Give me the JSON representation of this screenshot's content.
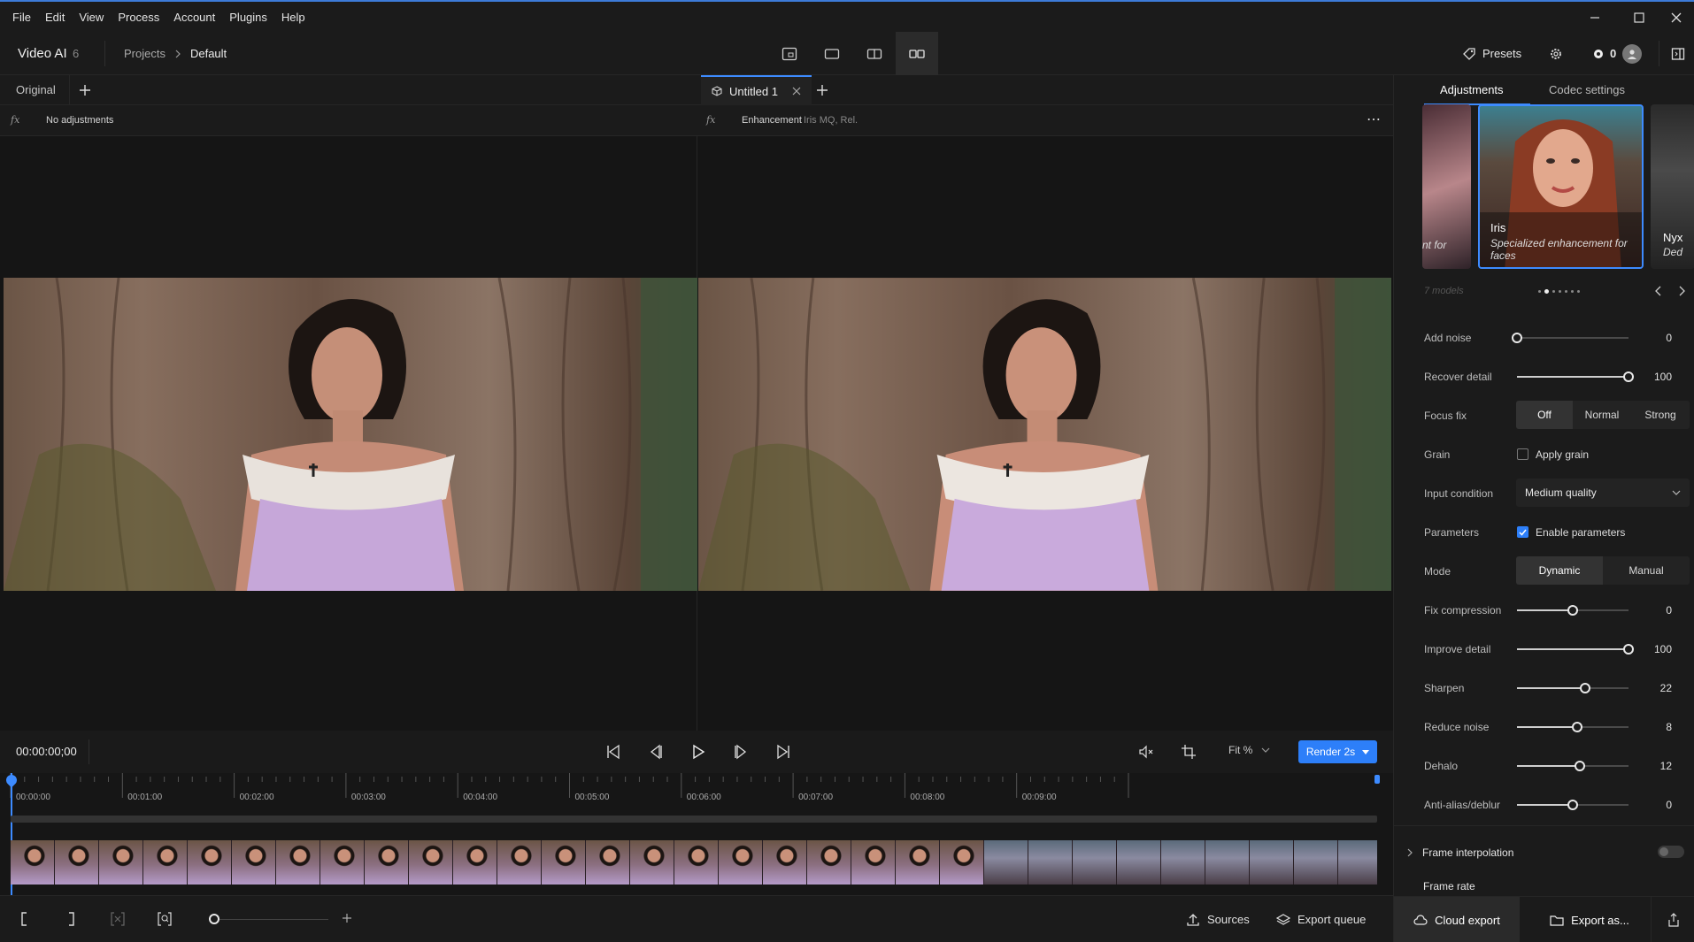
{
  "menu": [
    "File",
    "Edit",
    "View",
    "Process",
    "Account",
    "Plugins",
    "Help"
  ],
  "header": {
    "app_name": "Video AI",
    "app_version": "6",
    "breadcrumb_projects": "Projects",
    "breadcrumb_current": "Default",
    "presets_label": "Presets",
    "credits": "0"
  },
  "left_pane": {
    "tab_label": "Original",
    "fx_text": "No adjustments"
  },
  "right_pane": {
    "tab_label": "Untitled 1",
    "fx_label": "Enhancement",
    "fx_detail": "Iris MQ, Rel."
  },
  "playback": {
    "timecode": "00:00:00;00",
    "zoom_label": "Fit %",
    "render_label": "Render 2s"
  },
  "timeline": {
    "ticks": [
      "00:00:00",
      "00:01:00",
      "00:02:00",
      "00:03:00",
      "00:04:00",
      "00:05:00",
      "00:06:00",
      "00:07:00",
      "00:08:00",
      "00:09:00"
    ]
  },
  "bottom": {
    "sources_label": "Sources",
    "export_queue_label": "Export queue"
  },
  "panel": {
    "tab_adjustments": "Adjustments",
    "tab_codec": "Codec settings",
    "model_prev_partial": "nt for",
    "model_name": "Iris",
    "model_desc": "Specialized enhancement for faces",
    "model_next_name": "Nyx",
    "model_next_desc": "Ded",
    "model_count": "7 models",
    "carousel_total": 7,
    "carousel_active": 2,
    "add_noise": {
      "label": "Add noise",
      "value": 0,
      "max": 100
    },
    "recover_detail": {
      "label": "Recover detail",
      "value": 100,
      "max": 100
    },
    "focus_fix": {
      "label": "Focus fix",
      "options": [
        "Off",
        "Normal",
        "Strong"
      ],
      "selected": "Off"
    },
    "grain": {
      "label": "Grain",
      "checkbox_label": "Apply grain",
      "checked": false
    },
    "input_condition": {
      "label": "Input condition",
      "value": "Medium quality"
    },
    "parameters": {
      "label": "Parameters",
      "checkbox_label": "Enable parameters",
      "checked": true
    },
    "mode": {
      "label": "Mode",
      "options": [
        "Dynamic",
        "Manual"
      ],
      "selected": "Dynamic"
    },
    "fix_compression": {
      "label": "Fix compression",
      "value": 0,
      "fraction": 0.5
    },
    "improve_detail": {
      "label": "Improve detail",
      "value": 100,
      "fraction": 1.0
    },
    "sharpen": {
      "label": "Sharpen",
      "value": 22,
      "fraction": 0.61
    },
    "reduce_noise": {
      "label": "Reduce noise",
      "value": 8,
      "fraction": 0.54
    },
    "dehalo": {
      "label": "Dehalo",
      "value": 12,
      "fraction": 0.56
    },
    "anti_alias": {
      "label": "Anti-alias/deblur",
      "value": 0,
      "fraction": 0.5
    },
    "frame_interp": {
      "label": "Frame interpolation",
      "enabled": false
    },
    "frame_rate_label": "Frame rate",
    "cloud_export_label": "Cloud export",
    "export_as_label": "Export as..."
  },
  "colors": {
    "accent": "#2d7ff9",
    "playhead": "#3d8bff"
  }
}
